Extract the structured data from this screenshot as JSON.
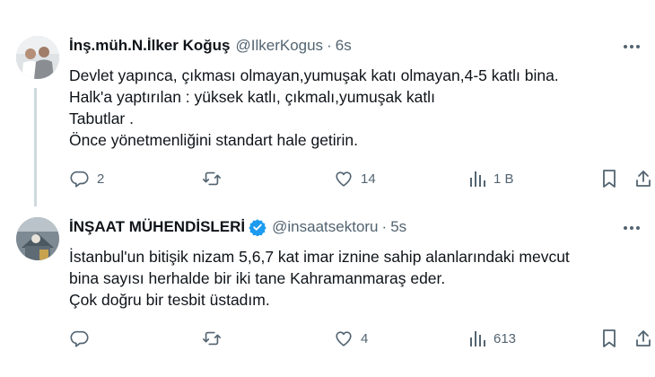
{
  "tweets": [
    {
      "name": "İnş.müh.N.İlker Koğuş",
      "handle": "@IlkerKogus",
      "separator": "·",
      "time": "6s",
      "verified": false,
      "lines": [
        "Devlet yapınca, çıkması olmayan,yumuşak katı olmayan,4-5 katlı bina.",
        "Halk'a yaptırılan : yüksek katlı, çıkmalı,yumuşak katlı",
        "Tabutlar .",
        "Önce yönetmenliğini standart hale getirin."
      ],
      "reply_count": "2",
      "retweet_count": "",
      "like_count": "14",
      "view_count": "1 B"
    },
    {
      "name": "İNŞAAT MÜHENDİSLERİ",
      "handle": "@insaatsektoru",
      "separator": "·",
      "time": "5s",
      "verified": true,
      "lines": [
        "İstanbul'un bitişik nizam 5,6,7 kat imar iznine sahip alanlarındaki mevcut",
        "bina sayısı herhalde bir iki tane Kahramanmaraş eder.",
        "Çok doğru bir tesbit üstadım."
      ],
      "reply_count": "",
      "retweet_count": "",
      "like_count": "4",
      "view_count": "613"
    }
  ],
  "colors": {
    "text": "#0f1419",
    "secondary": "#536471",
    "verified": "#1d9bf0",
    "thread_line": "#cfd9de"
  },
  "icons": [
    "more-icon",
    "reply-icon",
    "retweet-icon",
    "like-icon",
    "views-icon",
    "bookmark-icon",
    "share-icon",
    "verified-badge-icon"
  ]
}
